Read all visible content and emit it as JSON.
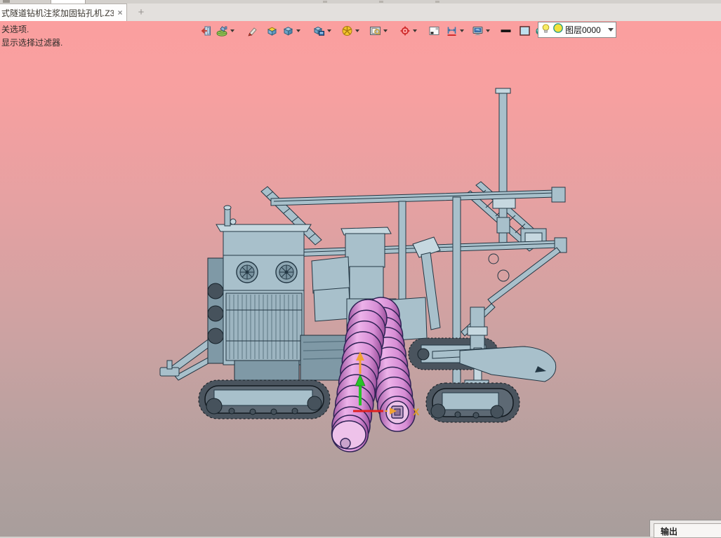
{
  "tab_bar": {
    "tab_title": "式隧道钻机注浆加固钻孔机.Z3",
    "close_glyph": "×",
    "new_tab_glyph": "+"
  },
  "prompt": {
    "line1": "关选项.",
    "line2": "显示选择过滤器."
  },
  "toolbar": {
    "icons": [
      {
        "name": "exit-icon",
        "dropdown": false
      },
      {
        "name": "face-color-icon",
        "dropdown": true
      },
      {
        "name": "eraser-icon",
        "dropdown": false
      },
      {
        "name": "extrude-box-icon",
        "dropdown": false
      },
      {
        "name": "shaded-cube-icon",
        "dropdown": true
      },
      {
        "name": "cube-display-icon",
        "dropdown": true
      },
      {
        "name": "section-wheel-icon",
        "dropdown": true
      },
      {
        "name": "zoom-window-icon",
        "dropdown": true
      },
      {
        "name": "target-icon",
        "dropdown": true
      },
      {
        "name": "corner-window-icon",
        "dropdown": false
      },
      {
        "name": "dimension-icon",
        "dropdown": true
      },
      {
        "name": "monitor-icon",
        "dropdown": true
      },
      {
        "name": "line-width-icon",
        "dropdown": false
      },
      {
        "name": "face-swatch-icon",
        "dropdown": false
      },
      {
        "name": "disc-icon",
        "dropdown": true
      }
    ],
    "layer_combo": {
      "value": "图层0000",
      "icons": [
        "bulb-icon",
        "layer-color-icon"
      ]
    }
  },
  "viewport": {
    "scene_description": "tracked tunnel drilling rig with twin pink augers",
    "axis_x_label": "X"
  },
  "output_panel": {
    "label": "输出"
  },
  "colors": {
    "viewport_top": "#fb9f9f",
    "viewport_bottom": "#a89e9c",
    "machine_body": "#a8c0cb",
    "auger_pink": "#d98ed6",
    "axis_red": "#e02020",
    "axis_green": "#27c427",
    "axis_orange": "#f2a232",
    "layer_swatch": "#f2e23a"
  }
}
